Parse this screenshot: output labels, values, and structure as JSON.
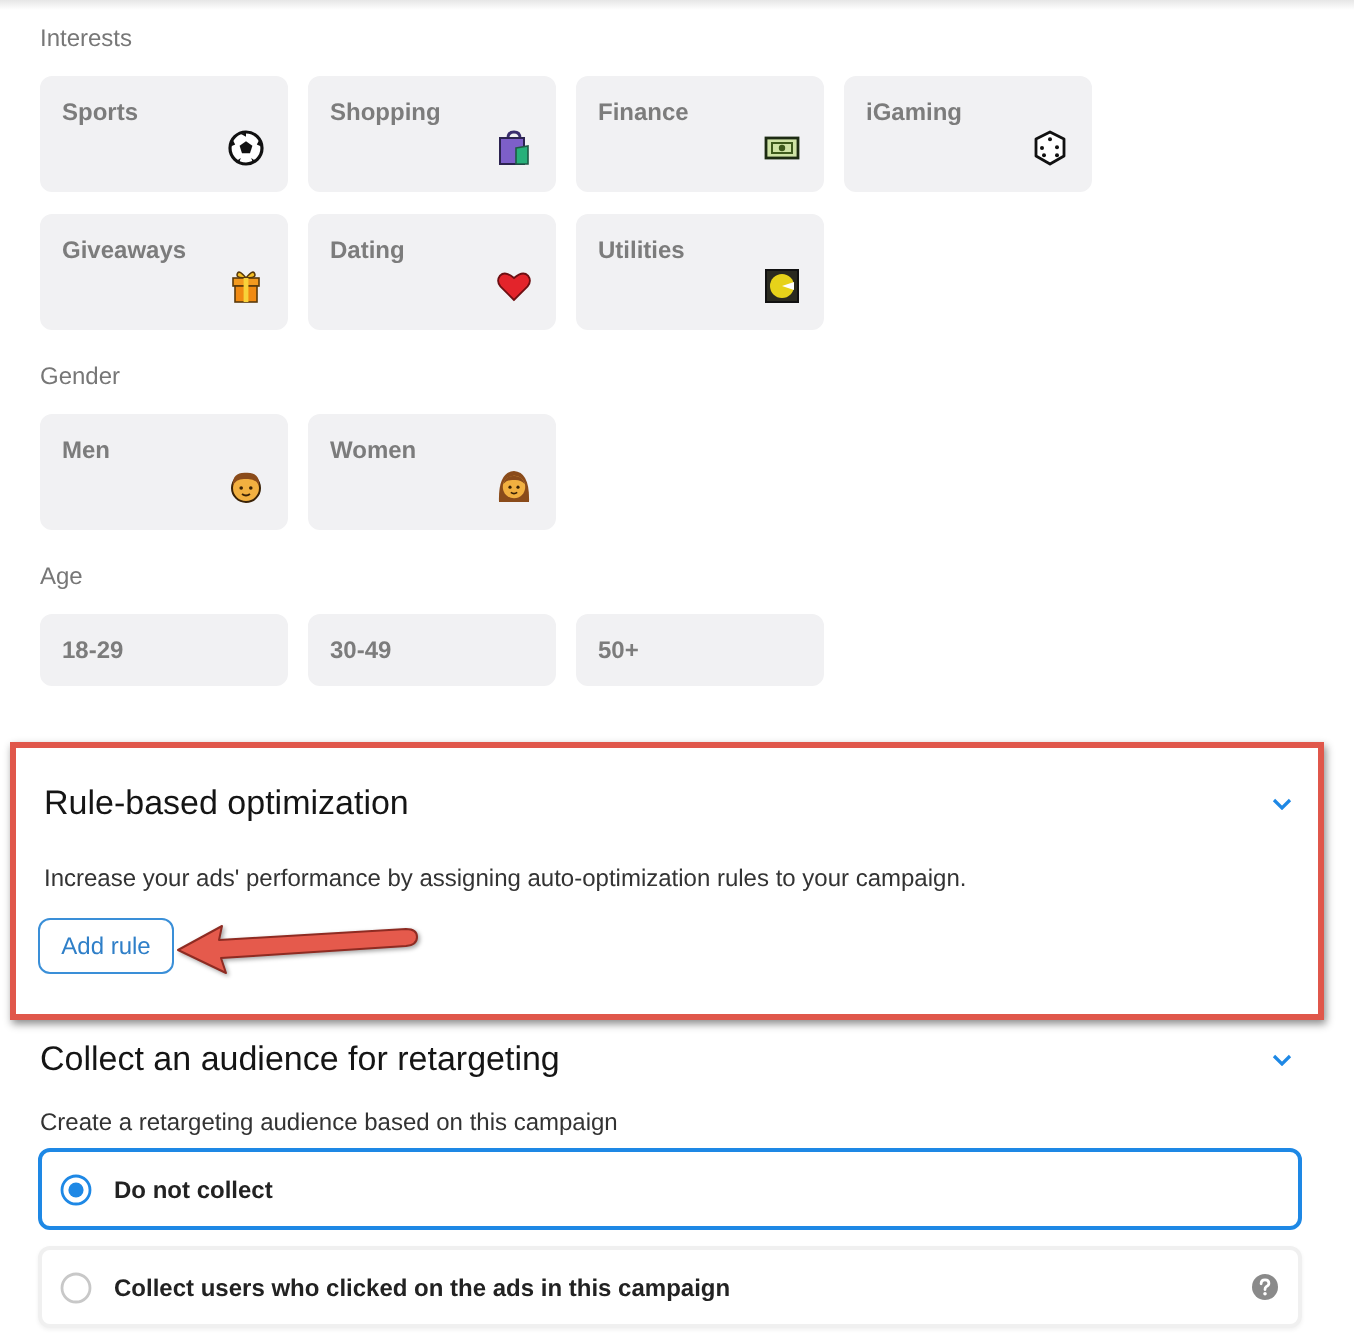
{
  "filters": [
    {
      "label": "Interests",
      "kind": "cards",
      "tiles": [
        {
          "label": "Sports",
          "selected": false
        },
        {
          "label": "Shopping",
          "selected": false
        },
        {
          "label": "Finance",
          "selected": false
        },
        {
          "label": "iGaming",
          "selected": false
        },
        {
          "label": "Giveaways",
          "selected": false
        },
        {
          "label": "Dating",
          "selected": false
        },
        {
          "label": "Utilities",
          "selected": false
        }
      ]
    },
    {
      "label": "Gender",
      "kind": "cards",
      "tiles": [
        {
          "label": "Men",
          "selected": false
        },
        {
          "label": "Women",
          "selected": false
        }
      ]
    },
    {
      "label": "Age",
      "kind": "chips",
      "tiles": [
        {
          "label": "18-29",
          "selected": false
        },
        {
          "label": "30-49",
          "selected": false
        },
        {
          "label": "50+",
          "selected": false
        }
      ]
    }
  ],
  "rule_optimization": {
    "title": "Rule-based optimization",
    "highlighted": true,
    "description": "Increase your ads' performance by assigning auto-optimization rules to your campaign.",
    "button": "Add rule"
  },
  "retargeting": {
    "title": "Collect an audience for retargeting",
    "description": "Create a retargeting audience based on this campaign",
    "options": [
      {
        "label": "Do not collect",
        "selected": true,
        "help": false
      },
      {
        "label": "Collect users who clicked on the ads in this campaign",
        "selected": false,
        "help": true
      }
    ]
  }
}
